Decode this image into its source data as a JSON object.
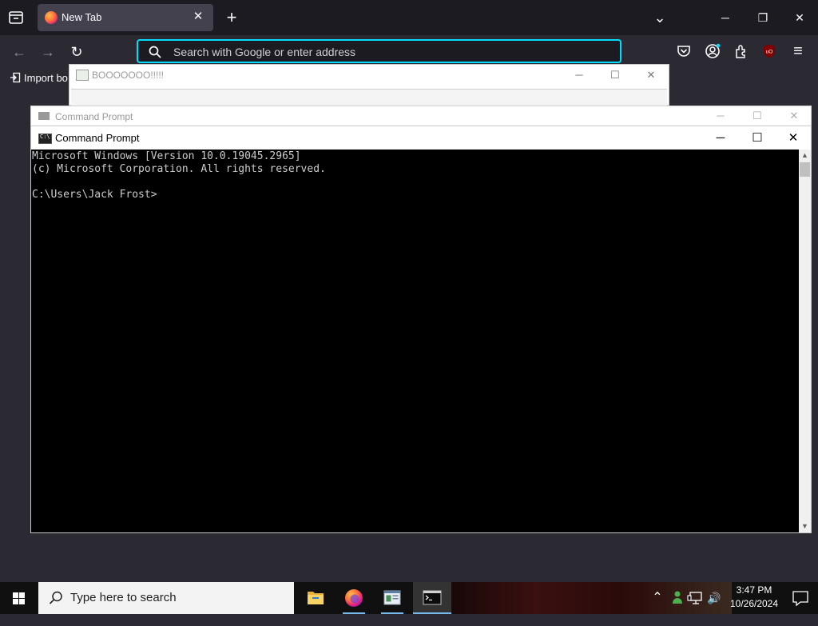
{
  "browser": {
    "tab": {
      "title": "New Tab",
      "close": "✕"
    },
    "new_tab": "+",
    "list_all_tabs": "⌄",
    "window_controls": {
      "minimize": "─",
      "restore": "❐",
      "close": "✕"
    },
    "nav": {
      "back": "←",
      "forward": "→",
      "reload": "↻"
    },
    "urlbar": {
      "placeholder": "Search with Google or enter address"
    },
    "bookmarks": {
      "import": "Import bo"
    },
    "toolbar_icons": [
      "pocket-icon",
      "account-icon",
      "extensions-icon",
      "ublock-icon",
      "menu-icon"
    ],
    "ublock_label": "uO",
    "menu_glyph": "≡",
    "accent": "#00ddff"
  },
  "boo_window": {
    "title": "BOOOOOOO!!!!!",
    "controls": {
      "minimize": "─",
      "maximize": "☐",
      "close": "✕"
    }
  },
  "cmd_bg": {
    "title": "Command Prompt",
    "controls": {
      "minimize": "─",
      "maximize": "☐",
      "close": "✕"
    }
  },
  "cmd": {
    "title": "Command Prompt",
    "controls": {
      "minimize": "─",
      "maximize": "☐",
      "close": "✕"
    },
    "lines": [
      "Microsoft Windows [Version 10.0.19045.2965]",
      "(c) Microsoft Corporation. All rights reserved.",
      "",
      "C:\\Users\\Jack Frost>"
    ],
    "scroll_up": "▲",
    "scroll_down": "▼"
  },
  "taskbar": {
    "search_placeholder": "Type here to search",
    "apps": [
      "file-explorer-icon",
      "firefox-icon",
      "app-window-icon",
      "command-prompt-icon"
    ],
    "tray": {
      "chevron": "⌃",
      "volume": "🔊"
    },
    "time": "3:47 PM",
    "date": "10/26/2024"
  }
}
